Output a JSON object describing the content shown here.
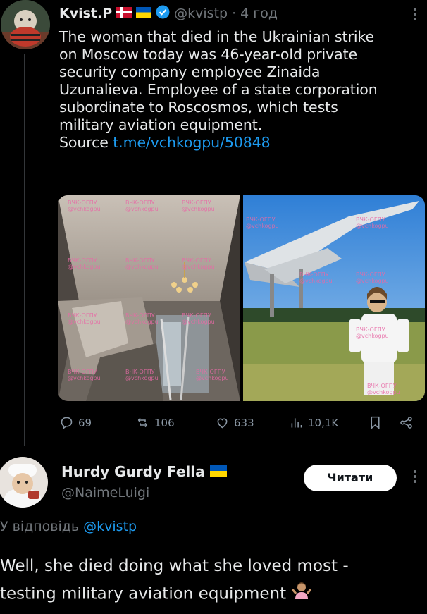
{
  "tweet": {
    "author_name": "Kvist.P",
    "handle": "@kvistp",
    "separator": "·",
    "time": "4 год",
    "text_lines": [
      "The woman that died in the Ukrainian strike",
      "on Moscow today was 46-year-old private",
      "security company employee Zinaida",
      "Uzunalieva. Employee of a state corporation",
      "subordinate to Roscosmos, which tests",
      "military aviation equipment."
    ],
    "source_label": "Source",
    "source_link": "t.me/vchkogpu/50848",
    "watermark": "ВЧК-ОГПУ",
    "watermark_handle": "@vchkogpu",
    "actions": {
      "replies": "69",
      "reposts": "106",
      "likes": "633",
      "views": "10,1K"
    }
  },
  "reply": {
    "author_name": "Hurdy Gurdy Fella",
    "handle": "@NaimeLuigi",
    "follow_button": "Читати",
    "replying_to_prefix": "У відповідь",
    "replying_to_handle": "@kvistp",
    "text_lines": [
      "Well, she died doing what she loved most -",
      "testing military aviation equipment"
    ]
  },
  "colors": {
    "background": "#000000",
    "text": "#e7e9ea",
    "muted": "#71767b",
    "link": "#1d9bf0",
    "verified": "#1d9bf0"
  }
}
